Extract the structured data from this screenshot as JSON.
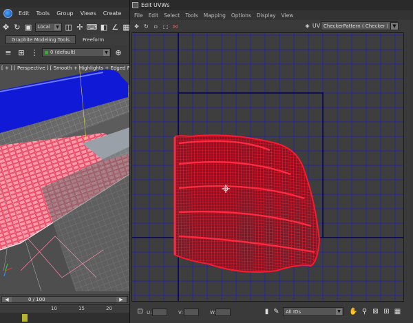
{
  "main_window": {
    "menu": [
      "Edit",
      "Tools",
      "Group",
      "Views",
      "Create"
    ],
    "reference_coord": "Local",
    "ribbon_tabs": [
      "Graphite Modeling Tools",
      "Freeform"
    ],
    "layer": "0 (default)",
    "viewport_label": "[ + ] [ Perspective ] [ Smooth + Highlights + Edged Faces ]",
    "time_slider": "0 / 100",
    "ruler_ticks": [
      "10",
      "15",
      "20"
    ]
  },
  "uvw_window": {
    "title": "Edit UVWs",
    "menu": [
      "File",
      "Edit",
      "Select",
      "Tools",
      "Mapping",
      "Options",
      "Display",
      "View"
    ],
    "texture_combo": "CheckerPattern  ( Checker )",
    "coord_labels": [
      "U:",
      "V:",
      "W:"
    ],
    "id_filter": "All IDs"
  },
  "colors": {
    "uv_grid": "#25259a",
    "uv_mesh": "#e8132b",
    "uv_bounds": "#0a0a55",
    "viewport_blue": "#0f19d6",
    "viewport_pink": "#ff8fa0"
  },
  "icons": {
    "logo": "3dsmax-logo-icon",
    "pan": "hand-icon",
    "zoom": "magnifier-icon"
  }
}
